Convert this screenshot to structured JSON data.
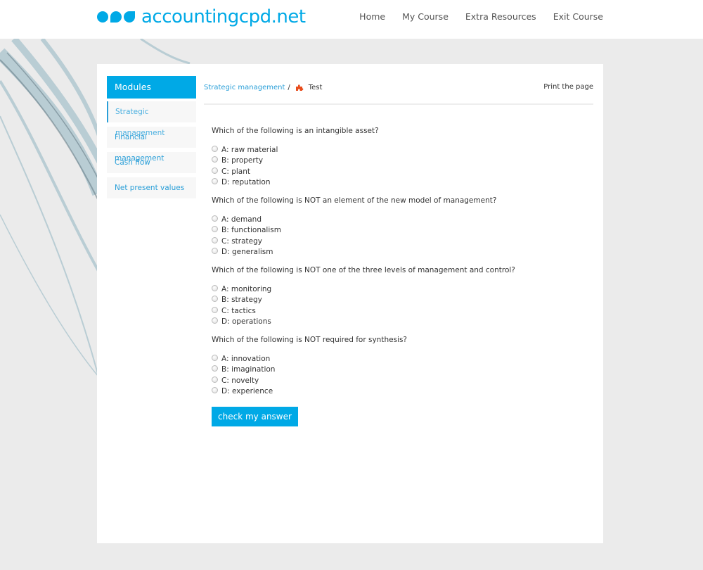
{
  "header": {
    "logo_text": "accountingcpd.net",
    "nav": [
      "Home",
      "My Course",
      "Extra Resources",
      "Exit Course"
    ]
  },
  "sidebar": {
    "title": "Modules",
    "items": [
      {
        "label": "Strategic management",
        "active": true
      },
      {
        "label": "Financial management",
        "active": false
      },
      {
        "label": "Cash flow",
        "active": false
      },
      {
        "label": "Net present values",
        "active": false
      }
    ]
  },
  "breadcrumb": {
    "parent": "Strategic management",
    "separator": "/",
    "icon": "puzzle-icon",
    "current": "Test"
  },
  "print_label": "Print the page",
  "quiz": {
    "questions": [
      {
        "text": "Which of the following is an intangible asset?",
        "options": [
          "A: raw material",
          "B: property",
          "C: plant",
          "D: reputation"
        ]
      },
      {
        "text": "Which of the following is NOT an element of the new model of management?",
        "options": [
          "A: demand",
          "B: functionalism",
          "C: strategy",
          "D: generalism"
        ]
      },
      {
        "text": "Which of the following is NOT one of the three levels of management and control?",
        "options": [
          "A: monitoring",
          "B: strategy",
          "C: tactics",
          "D: operations"
        ]
      },
      {
        "text": "Which of the following is NOT required for synthesis?",
        "options": [
          "A: innovation",
          "B: imagination",
          "C: novelty",
          "D: experience"
        ]
      }
    ],
    "submit_label": "check my answer"
  },
  "colors": {
    "accent": "#00a9e6",
    "link": "#2a9fd8",
    "puzzle": "#e84c1c"
  }
}
